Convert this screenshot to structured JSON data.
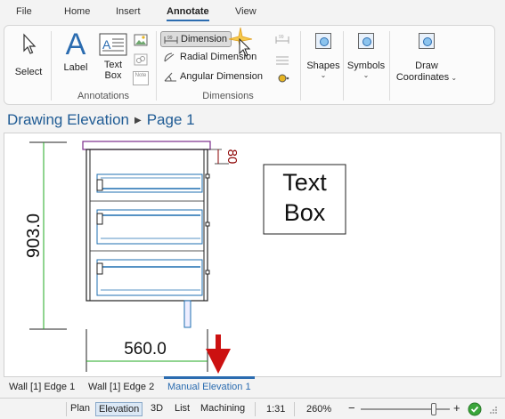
{
  "menu": {
    "tabs": [
      "File",
      "Home",
      "Insert",
      "Annotate",
      "View"
    ],
    "active": "Annotate"
  },
  "ribbon": {
    "select_label": "Select",
    "label_label": "Label",
    "textbox_line1": "Text",
    "textbox_line2": "Box",
    "annotations_group": "Annotations",
    "dimension_label": "Dimension",
    "radial_label": "Radial Dimension",
    "angular_label": "Angular Dimension",
    "dimensions_group": "Dimensions",
    "shapes_label": "Shapes",
    "symbols_label": "Symbols",
    "draw_coord_line1": "Draw",
    "draw_coord_line2": "Coordinates",
    "note_icon_text": "Note"
  },
  "breadcrumb": {
    "part1": "Drawing Elevation",
    "part2": "Page 1"
  },
  "drawing": {
    "height_dim": "903.0",
    "width_dim": "560.0",
    "small_dim": "80",
    "textbox_line1": "Text",
    "textbox_line2": "Box",
    "colors": {
      "dim_line": "#22aa22",
      "small_dim": "#8b0000",
      "top_panel": "#7b2b8b",
      "drawer_line": "#1f6fb0",
      "arrow": "#cc1111"
    }
  },
  "sheets": {
    "items": [
      "Wall [1] Edge 1",
      "Wall [1] Edge 2",
      "Manual Elevation 1"
    ],
    "active": "Manual Elevation 1"
  },
  "status": {
    "views": [
      "Plan",
      "Elevation",
      "3D",
      "List",
      "Machining"
    ],
    "active_view": "Elevation",
    "scale": "1:31",
    "zoom": "260%",
    "zoom_out": "−",
    "zoom_in": "+",
    "zoom_level": 0.82
  }
}
